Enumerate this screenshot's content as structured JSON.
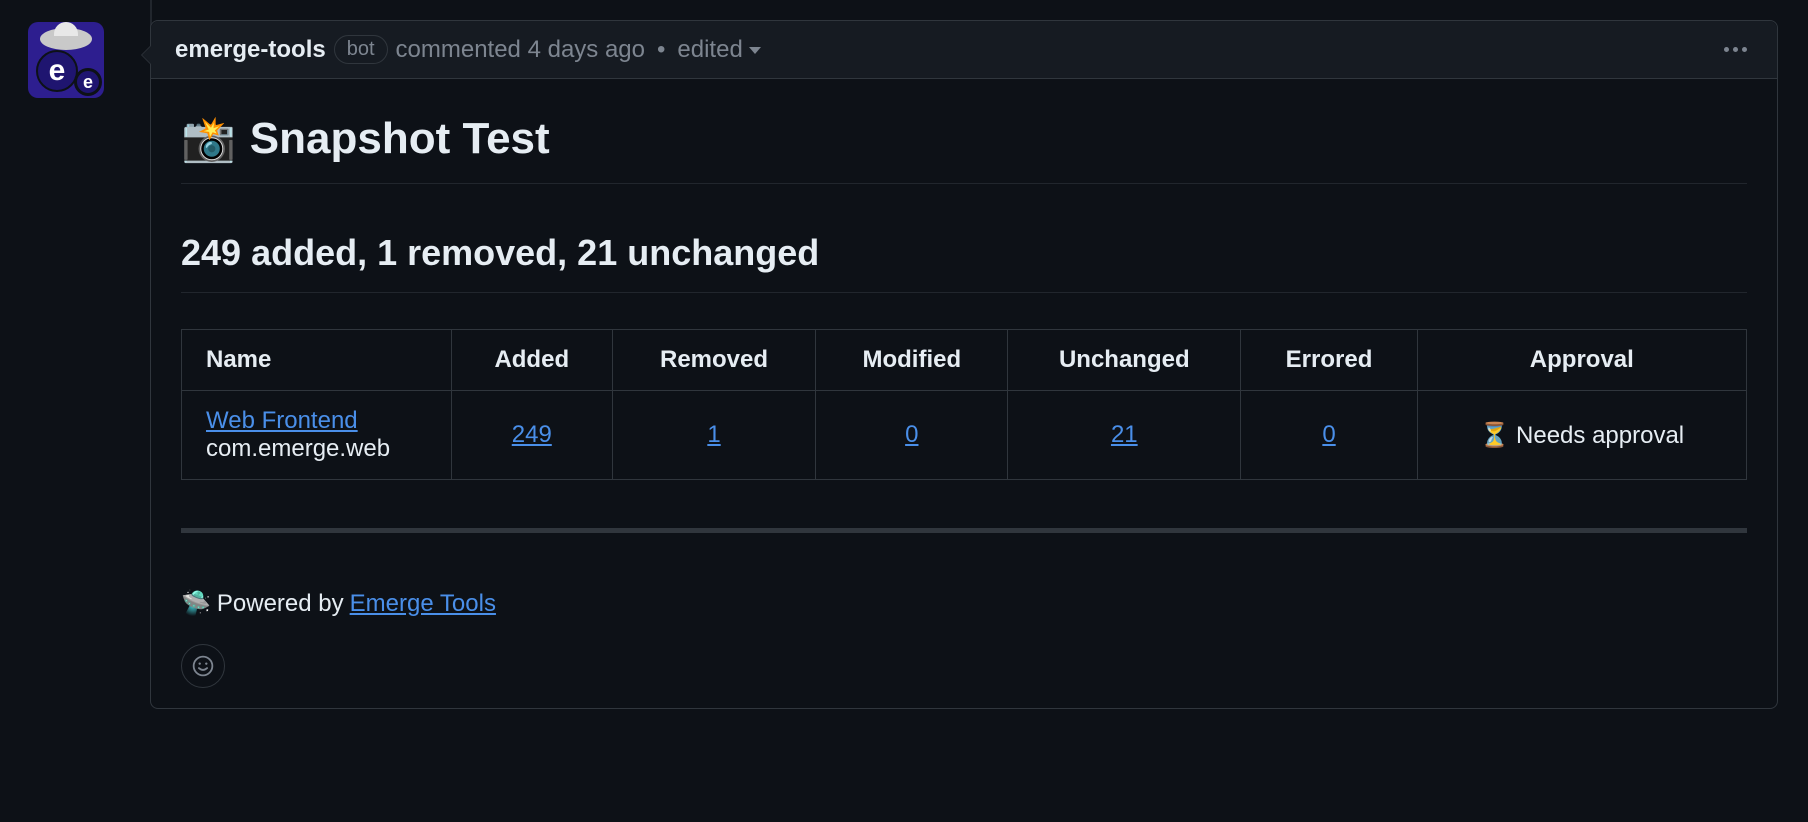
{
  "comment": {
    "author": "emerge-tools",
    "author_badge": "bot",
    "action_text": "commented",
    "timestamp": "4 days ago",
    "edited_label": "edited"
  },
  "body": {
    "title_icon": "📸",
    "title": "Snapshot Test",
    "summary": "249 added, 1 removed, 21 unchanged"
  },
  "table": {
    "headers": {
      "name": "Name",
      "added": "Added",
      "removed": "Removed",
      "modified": "Modified",
      "unchanged": "Unchanged",
      "errored": "Errored",
      "approval": "Approval"
    },
    "rows": [
      {
        "name": "Web Frontend",
        "package": "com.emerge.web",
        "added": "249",
        "removed": "1",
        "modified": "0",
        "unchanged": "21",
        "errored": "0",
        "approval_icon": "⏳",
        "approval_text": "Needs approval"
      }
    ]
  },
  "footer": {
    "ufo_icon": "🛸",
    "prefix": "Powered by",
    "link_text": "Emerge Tools"
  }
}
